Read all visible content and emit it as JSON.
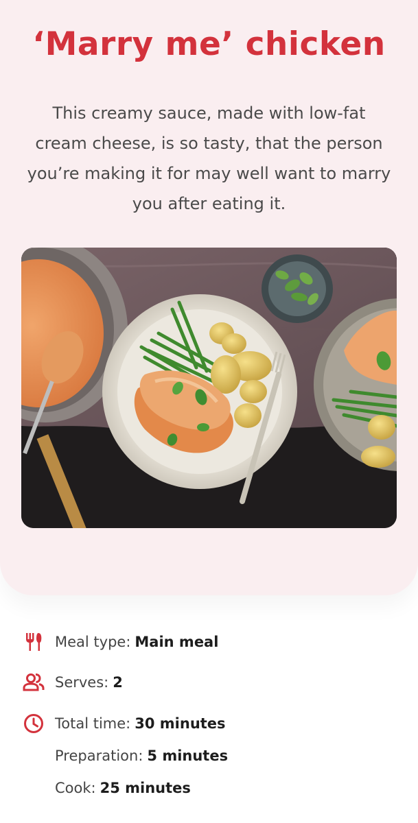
{
  "recipe": {
    "title": "‘Marry me’ chicken",
    "description": "This creamy sauce, made with low-fat cream cheese, is so tasty, that the person you’re making it for may well want to marry you after eating it.",
    "image_alt": "Chicken breast in creamy sauce with green beans and new potatoes"
  },
  "details": {
    "meal_type": {
      "icon": "cutlery-icon",
      "label": "Meal type:",
      "value": "Main meal"
    },
    "serves": {
      "icon": "people-icon",
      "label": "Serves:",
      "value": "2"
    },
    "total_time": {
      "icon": "clock-icon",
      "label": "Total time:",
      "value": "30 minutes"
    },
    "preparation": {
      "label": "Preparation:",
      "value": "5 minutes"
    },
    "cook": {
      "label": "Cook:",
      "value": "25 minutes"
    }
  },
  "colors": {
    "accent": "#d3323c",
    "hero_background": "#faeef0",
    "text": "#444444"
  }
}
